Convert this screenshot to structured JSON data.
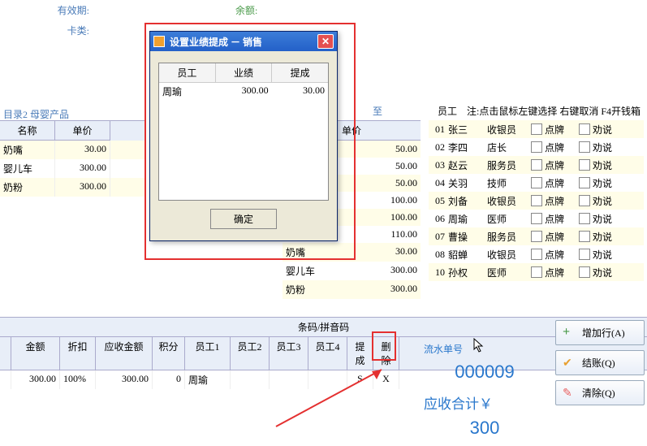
{
  "header": {
    "validity_label": "有效期:",
    "card_type_label": "卡类:",
    "balance_label": "余额:"
  },
  "dialog": {
    "title": "设置业绩提成 － 销售",
    "columns": [
      "员工",
      "业绩",
      "提成"
    ],
    "row": {
      "name": "周瑜",
      "perf": "300.00",
      "comm": "30.00"
    },
    "ok": "确定"
  },
  "catalog_label": "目录2 母婴产品",
  "catalog_label2": "目",
  "left_table": {
    "headers": [
      "名称",
      "单价"
    ],
    "rows": [
      {
        "name": "奶嘴",
        "price": "30.00"
      },
      {
        "name": "婴儿车",
        "price": "300.00"
      },
      {
        "name": "奶粉",
        "price": "300.00"
      }
    ]
  },
  "mid_slice": [
    "奶",
    "婴",
    "奶"
  ],
  "mid_table2": {
    "header": "单价",
    "rows": [
      {
        "name": "",
        "price": "50.00"
      },
      {
        "name": "",
        "price": "50.00"
      },
      {
        "name": "",
        "price": "50.00"
      },
      {
        "name": "",
        "price": "100.00"
      },
      {
        "name": "",
        "price": "100.00"
      },
      {
        "name": "",
        "price": "110.00"
      },
      {
        "name": "奶嘴",
        "price": "30.00"
      },
      {
        "name": "婴儿车",
        "price": "300.00"
      },
      {
        "name": "奶粉",
        "price": "300.00"
      }
    ]
  },
  "to_label": "至",
  "emp": {
    "label": "员工",
    "hint": "注:点击鼠标左键选择 右键取消 F4开钱箱",
    "cb_labels": [
      "点牌",
      "劝说"
    ],
    "rows": [
      {
        "id": "01",
        "name": "张三",
        "role": "收银员"
      },
      {
        "id": "02",
        "name": "李四",
        "role": "店长"
      },
      {
        "id": "03",
        "name": "赵云",
        "role": "服务员"
      },
      {
        "id": "04",
        "name": "关羽",
        "role": "技师"
      },
      {
        "id": "05",
        "name": "刘备",
        "role": "收银员"
      },
      {
        "id": "06",
        "name": "周瑜",
        "role": "医师"
      },
      {
        "id": "07",
        "name": "曹操",
        "role": "服务员"
      },
      {
        "id": "08",
        "name": "貂蝉",
        "role": "收银员"
      },
      {
        "id": "10",
        "name": "孙权",
        "role": "医师"
      }
    ]
  },
  "bottom": {
    "title": "条码/拼音码",
    "cols": [
      "",
      "金额",
      "折扣",
      "应收金额",
      "积分",
      "员工1",
      "员工2",
      "员工3",
      "员工4",
      "提成",
      "删除"
    ],
    "row": [
      "",
      "300.00",
      "100%",
      "300.00",
      "0",
      "周瑜",
      "",
      "",
      "",
      "S",
      "X"
    ]
  },
  "summary": {
    "serial_label": "流水单号",
    "serial_value": "000009",
    "total_label": "应收合计￥",
    "total_value": "300"
  },
  "buttons": {
    "add": "增加行(A)",
    "checkout": "结账(Q)",
    "clear": "清除(Q)"
  }
}
